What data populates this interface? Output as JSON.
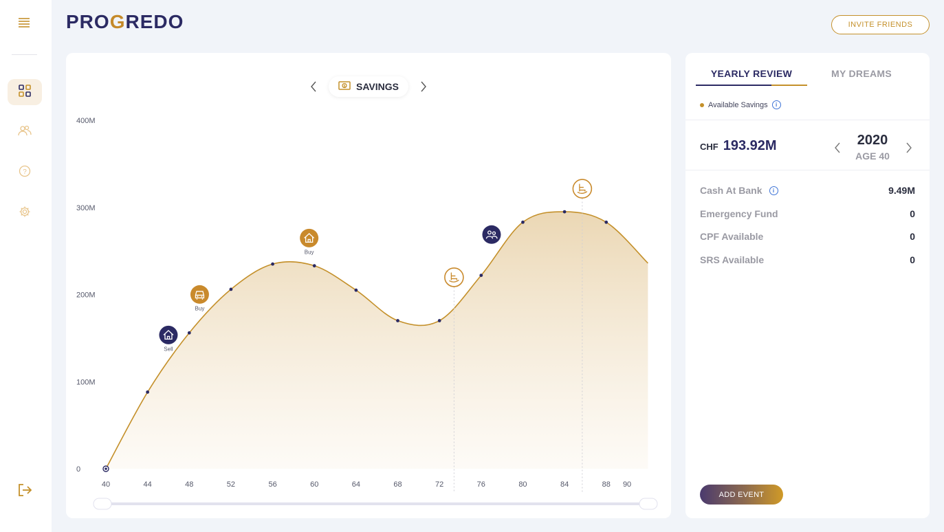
{
  "brand": {
    "logo_part1": "PRO",
    "logo_g": "G",
    "logo_part2": "REDO"
  },
  "header": {
    "invite_label": "INVITE FRIENDS"
  },
  "sidebar": {
    "items": [
      {
        "name": "dashboard",
        "icon": "grid-icon",
        "active": true
      },
      {
        "name": "people",
        "icon": "people-icon",
        "active": false
      },
      {
        "name": "help",
        "icon": "help-icon",
        "active": false
      },
      {
        "name": "settings",
        "icon": "gear-icon",
        "active": false
      }
    ],
    "logout_icon": "logout-icon"
  },
  "chart_nav": {
    "label": "SAVINGS",
    "icon": "money-icon"
  },
  "chart_data": {
    "type": "area",
    "title": "SAVINGS",
    "y_ticks": [
      "400M",
      "300M",
      "200M",
      "100M",
      "0"
    ],
    "x_ticks": [
      "40",
      "44",
      "48",
      "52",
      "56",
      "60",
      "64",
      "68",
      "72",
      "76",
      "80",
      "84",
      "88",
      "90"
    ],
    "ylim": [
      0,
      400
    ],
    "x": [
      40,
      44,
      48,
      52,
      56,
      60,
      64,
      68,
      72,
      76,
      80,
      84,
      88,
      92
    ],
    "values": [
      0,
      88,
      156,
      206,
      235,
      233,
      205,
      170,
      170,
      222,
      283,
      295,
      283,
      236
    ],
    "events": [
      {
        "age": 46,
        "label": "Sell",
        "icon": "house-icon",
        "style": "navy"
      },
      {
        "age": 49,
        "label": "Buy",
        "icon": "car-icon",
        "style": "gold"
      },
      {
        "age": 59.5,
        "label": "Buy",
        "icon": "house-icon",
        "style": "gold"
      },
      {
        "age": 73.4,
        "label": "",
        "icon": "rocking-chair-icon",
        "style": "outline",
        "vline": true
      },
      {
        "age": 77,
        "label": "",
        "icon": "family-icon",
        "style": "navy"
      },
      {
        "age": 85.7,
        "label": "",
        "icon": "rocking-chair-icon",
        "style": "outline",
        "vline": true
      }
    ],
    "colors": {
      "line": "#c4902a",
      "point": "#2b2a63",
      "navy": "#2b2a63",
      "gold": "#c98a2c"
    }
  },
  "review": {
    "tab_active": "YEARLY REVIEW",
    "tab_inactive": "MY DREAMS",
    "legend": "Available Savings",
    "currency": "CHF",
    "amount": "193.92M",
    "year": "2020",
    "age": "AGE 40",
    "rows": [
      {
        "label": "Cash At Bank",
        "value": "9.49M",
        "info": true
      },
      {
        "label": "Emergency Fund",
        "value": "0",
        "info": false
      },
      {
        "label": "CPF Available",
        "value": "0",
        "info": false
      },
      {
        "label": "SRS Available",
        "value": "0",
        "info": false
      }
    ],
    "add_event": "ADD EVENT"
  }
}
